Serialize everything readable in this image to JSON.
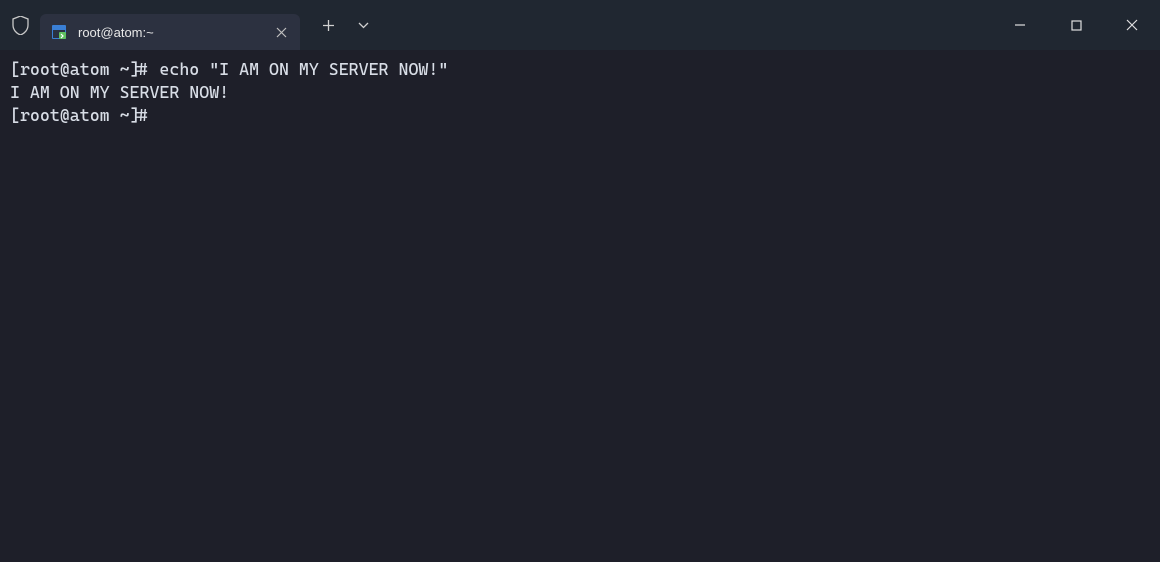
{
  "tab": {
    "title": "root@atom:~"
  },
  "terminal": {
    "line1": "[root@atom ~]# echo \"I AM ON MY SERVER NOW!\"",
    "line2": "I AM ON MY SERVER NOW!",
    "line3": "[root@atom ~]# "
  }
}
